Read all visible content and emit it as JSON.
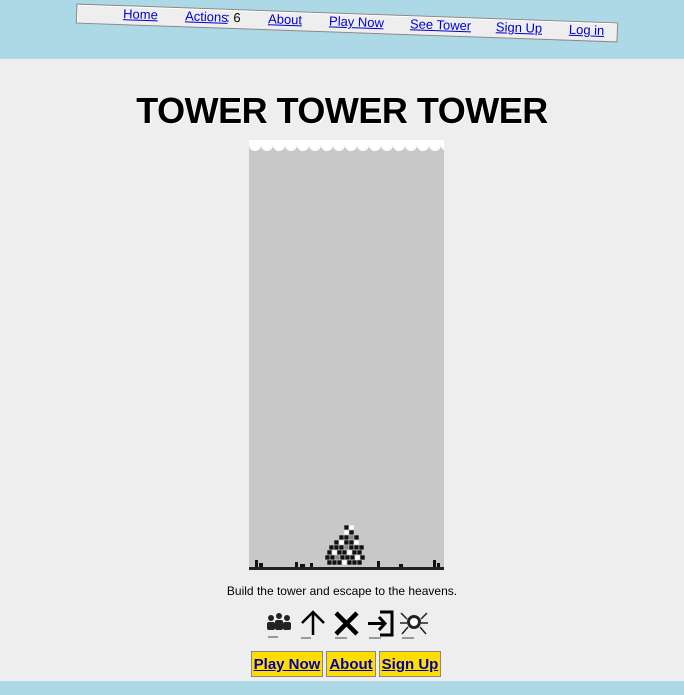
{
  "nav": {
    "home": "Home",
    "actions": "Actions",
    "actions_count": ": 6",
    "about": "About",
    "play_now": "Play Now",
    "see_tower": "See Tower",
    "sign_up": "Sign Up",
    "log_in": "Log in"
  },
  "title": "TOWER TOWER TOWER",
  "tagline": "Build the tower and escape to the heavens.",
  "buttons": {
    "play_now": "Play Now",
    "about": "About",
    "sign_up": "Sign Up"
  },
  "icons": [
    "people-icon",
    "up-arrow-icon",
    "close-icon",
    "exit-icon",
    "spider-icon"
  ],
  "colors": {
    "bar": "#add8e6",
    "button": "#ffdd00",
    "link": "#0000cc",
    "game_bg": "#c8c8c8"
  }
}
